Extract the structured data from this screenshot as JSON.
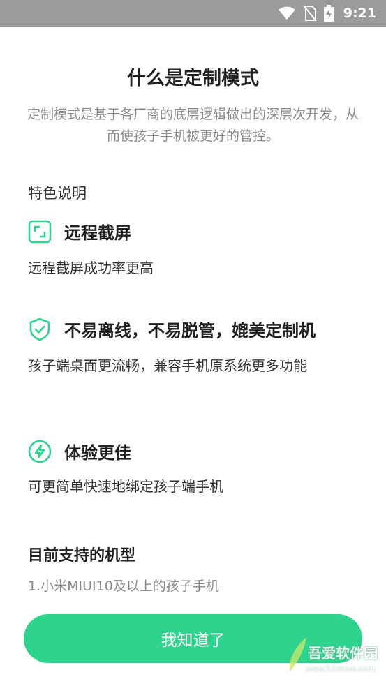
{
  "status_bar": {
    "time": "9:21",
    "icons": [
      "wifi-icon",
      "no-sim-icon",
      "battery-charging-icon"
    ]
  },
  "title": "什么是定制模式",
  "description": "定制模式是基于各厂商的底层逻辑做出的深层次开发，从而使孩子手机被更好的管控。",
  "features_label": "特色说明",
  "features": [
    {
      "icon": "screenshot-frame-icon",
      "title": "远程截屏",
      "desc": "远程截屏成功率更高"
    },
    {
      "icon": "shield-check-icon",
      "title": "不易离线，不易脱管，媲美定制机",
      "desc": "孩子端桌面更流畅，兼容手机原系统更多功能"
    },
    {
      "icon": "lightning-circle-icon",
      "title": "体验更佳",
      "desc": "可更简单快速地绑定孩子端手机"
    }
  ],
  "support": {
    "title": "目前支持的机型",
    "items": [
      "1.小米MIUI10及以上的孩子手机"
    ]
  },
  "confirm_button": "我知道了",
  "watermark": {
    "cn": "吾爱软件园",
    "url": "www.52zixue.com"
  },
  "colors": {
    "accent": "#2ed38e",
    "status_bar": "#9b9b9b"
  }
}
